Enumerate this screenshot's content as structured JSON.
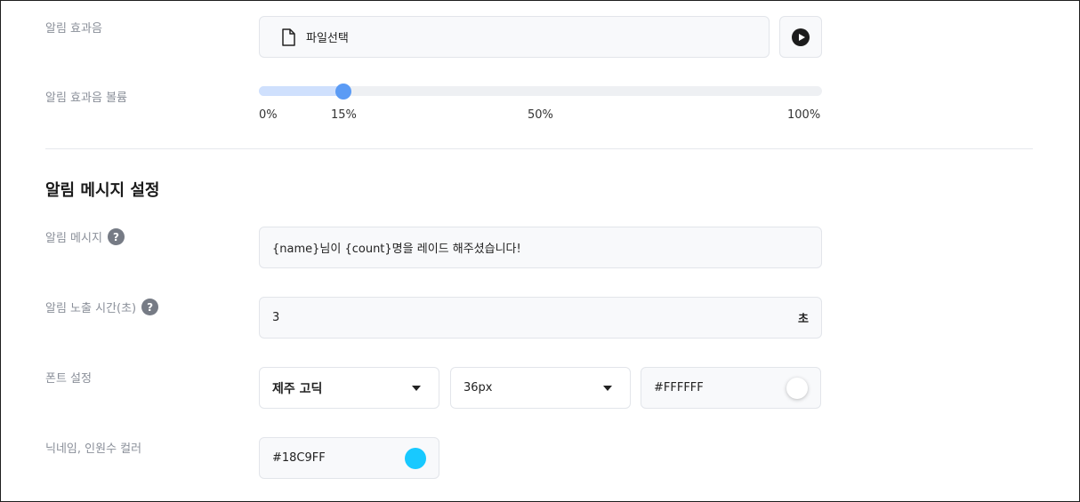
{
  "sound": {
    "label": "알림 효과음",
    "file_button_label": "파일선택",
    "file_icon": "file-icon",
    "play_icon": "play-icon"
  },
  "volume": {
    "label": "알림 효과음 볼륨",
    "value_percent": 15,
    "ticks": [
      "0%",
      "15%",
      "50%",
      "100%"
    ]
  },
  "message_section": {
    "title": "알림 메시지 설정",
    "message": {
      "label": "알림 메시지",
      "help_icon": "?",
      "value": "{name}님이 {count}명을 레이드 해주셨습니다!"
    },
    "duration": {
      "label": "알림 노출 시간(초)",
      "help_icon": "?",
      "value": "3",
      "unit": "초"
    },
    "font": {
      "label": "폰트 설정",
      "family": "제주 고딕",
      "size": "36px",
      "color": "#FFFFFF",
      "swatch_color": "#FFFFFF"
    },
    "nickname_color": {
      "label": "닉네임, 인원수 컬러",
      "value": "#18C9FF",
      "swatch_color": "#18C9FF"
    }
  }
}
